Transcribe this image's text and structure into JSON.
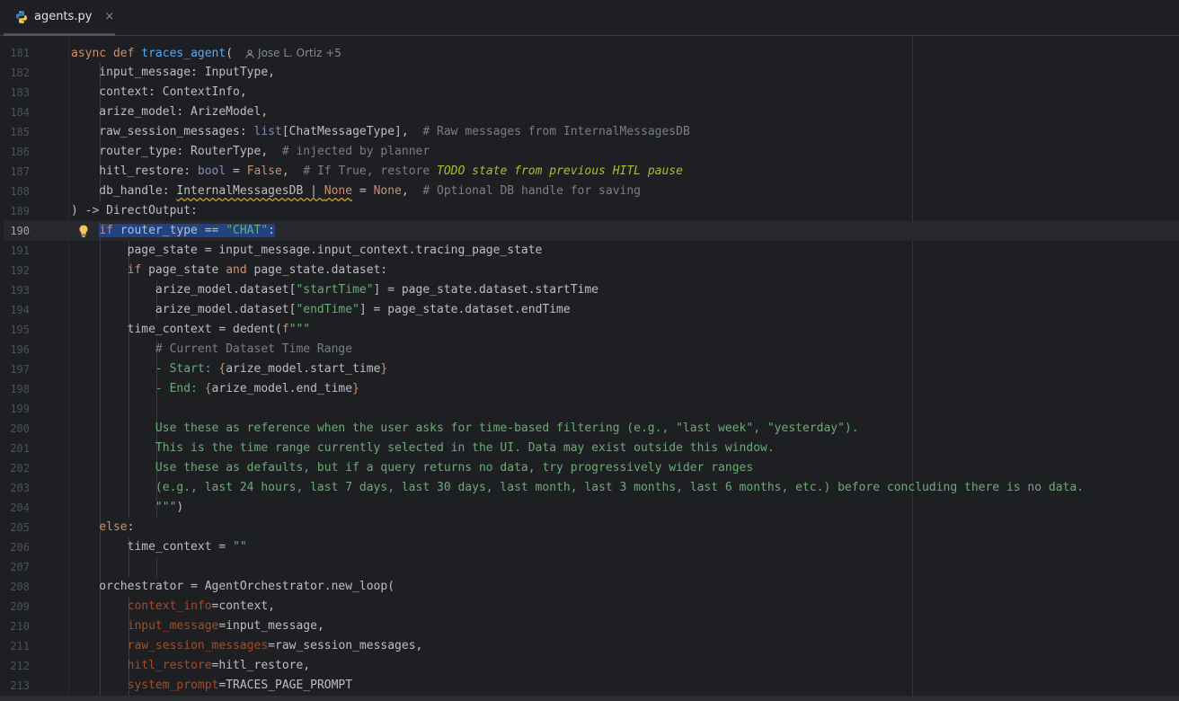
{
  "tab": {
    "filename": "agents.py",
    "close_glyph": "×"
  },
  "inlay_hint": "Jose L. Ortiz +5",
  "colors": {
    "background": "#1e1f22",
    "keyword": "#cf8e6d",
    "function": "#56a8f5",
    "string": "#6aab73",
    "comment": "#7a7e85",
    "todo": "#a8c023",
    "builtin": "#8888c6",
    "param": "#aa4926",
    "selection": "#214283"
  },
  "editor": {
    "current_line": "190",
    "lines": [
      {
        "n": "181",
        "c": "async def traces_agent("
      },
      {
        "n": "182",
        "c": "    input_message: InputType,"
      },
      {
        "n": "183",
        "c": "    context: ContextInfo,"
      },
      {
        "n": "184",
        "c": "    arize_model: ArizeModel,"
      },
      {
        "n": "185",
        "c": "    raw_session_messages: list[ChatMessageType],  # Raw messages from InternalMessagesDB"
      },
      {
        "n": "186",
        "c": "    router_type: RouterType,  # injected by planner"
      },
      {
        "n": "187",
        "c": "    hitl_restore: bool = False,  # If True, restore TODO state from previous HITL pause"
      },
      {
        "n": "188",
        "c": "    db_handle: InternalMessagesDB | None = None,  # Optional DB handle for saving"
      },
      {
        "n": "189",
        "c": ") -> DirectOutput:"
      },
      {
        "n": "190",
        "c": "    if router_type == \"CHAT\":"
      },
      {
        "n": "191",
        "c": "        page_state = input_message.input_context.tracing_page_state"
      },
      {
        "n": "192",
        "c": "        if page_state and page_state.dataset:"
      },
      {
        "n": "193",
        "c": "            arize_model.dataset[\"startTime\"] = page_state.dataset.startTime"
      },
      {
        "n": "194",
        "c": "            arize_model.dataset[\"endTime\"] = page_state.dataset.endTime"
      },
      {
        "n": "195",
        "c": "        time_context = dedent(f\"\"\""
      },
      {
        "n": "196",
        "c": "            # Current Dataset Time Range"
      },
      {
        "n": "197",
        "c": "            - Start: {arize_model.start_time}"
      },
      {
        "n": "198",
        "c": "            - End: {arize_model.end_time}"
      },
      {
        "n": "199",
        "c": ""
      },
      {
        "n": "200",
        "c": "            Use these as reference when the user asks for time-based filtering (e.g., \"last week\", \"yesterday\")."
      },
      {
        "n": "201",
        "c": "            This is the time range currently selected in the UI. Data may exist outside this window."
      },
      {
        "n": "202",
        "c": "            Use these as defaults, but if a query returns no data, try progressively wider ranges"
      },
      {
        "n": "203",
        "c": "            (e.g., last 24 hours, last 7 days, last 30 days, last month, last 3 months, last 6 months, etc.) before concluding there is no data."
      },
      {
        "n": "204",
        "c": "            \"\"\")"
      },
      {
        "n": "205",
        "c": "    else:"
      },
      {
        "n": "206",
        "c": "        time_context = \"\""
      },
      {
        "n": "207",
        "c": ""
      },
      {
        "n": "208",
        "c": "    orchestrator = AgentOrchestrator.new_loop("
      },
      {
        "n": "209",
        "c": "        context_info=context,"
      },
      {
        "n": "210",
        "c": "        input_message=input_message,"
      },
      {
        "n": "211",
        "c": "        raw_session_messages=raw_session_messages,"
      },
      {
        "n": "212",
        "c": "        hitl_restore=hitl_restore,"
      },
      {
        "n": "213",
        "c": "        system_prompt=TRACES_PAGE_PROMPT"
      }
    ]
  }
}
